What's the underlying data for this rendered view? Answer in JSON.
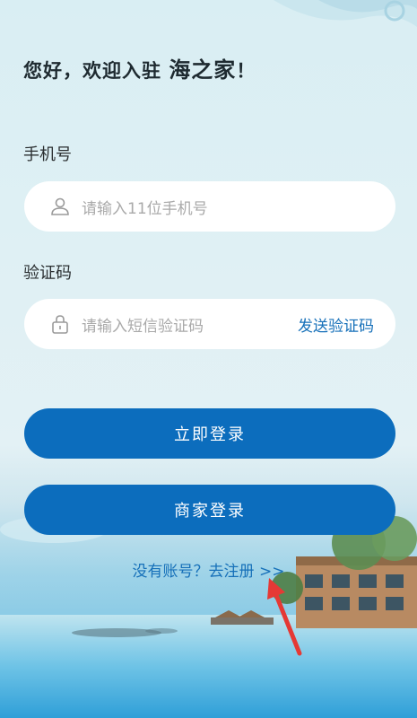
{
  "greeting": {
    "prefix": "您好，欢迎入驻 ",
    "brand": "海之家",
    "suffix": "！"
  },
  "phone": {
    "label": "手机号",
    "placeholder": "请输入11位手机号",
    "icon": "user-icon"
  },
  "code": {
    "label": "验证码",
    "placeholder": "请输入短信验证码",
    "send_label": "发送验证码",
    "icon": "lock-icon"
  },
  "buttons": {
    "login": "立即登录",
    "merchant_login": "商家登录"
  },
  "register_link": "没有账号？去注册 >>",
  "colors": {
    "primary": "#0c6dbd",
    "link": "#1670b9",
    "annotation_arrow": "#e53935"
  }
}
